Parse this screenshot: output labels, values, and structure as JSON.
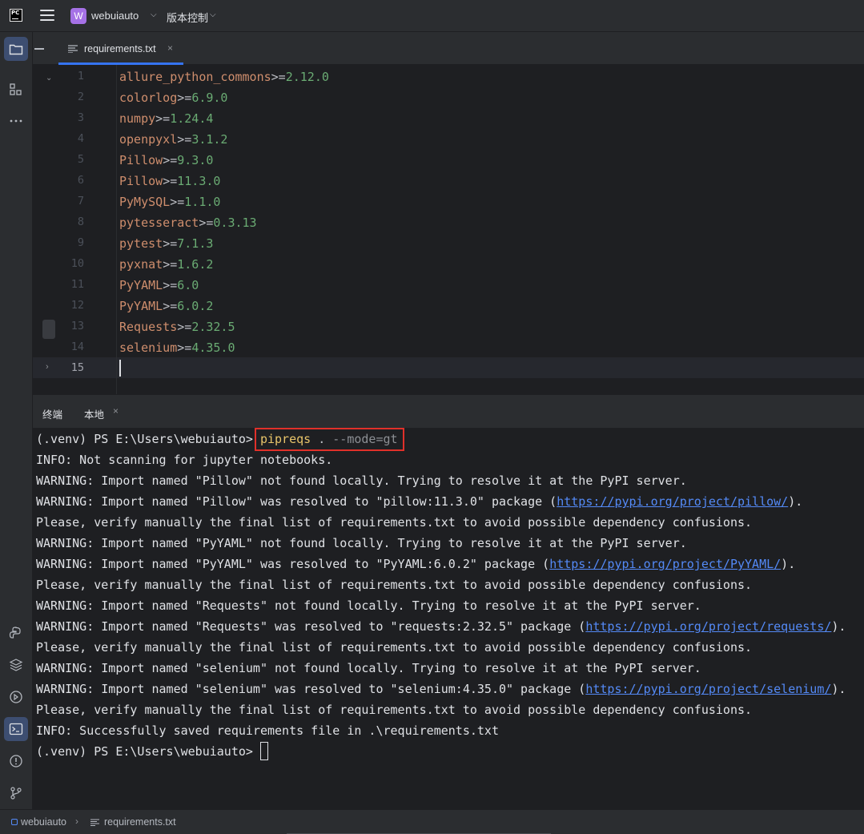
{
  "titlebar": {
    "app_logo": "PC",
    "project_badge": "W",
    "project_name": "webuiauto",
    "vcs_label": "版本控制"
  },
  "editor_tab": {
    "label": "requirements.txt",
    "close": "×"
  },
  "editor": {
    "lines": [
      {
        "no": "1",
        "pkg": "allure_python_commons",
        "op": ">=",
        "ver": "2.12.0"
      },
      {
        "no": "2",
        "pkg": "colorlog",
        "op": ">=",
        "ver": "6.9.0"
      },
      {
        "no": "3",
        "pkg": "numpy",
        "op": ">=",
        "ver": "1.24.4"
      },
      {
        "no": "4",
        "pkg": "openpyxl",
        "op": ">=",
        "ver": "3.1.2"
      },
      {
        "no": "5",
        "pkg": "Pillow",
        "op": ">=",
        "ver": "9.3.0"
      },
      {
        "no": "6",
        "pkg": "Pillow",
        "op": ">=",
        "ver": "11.3.0"
      },
      {
        "no": "7",
        "pkg": "PyMySQL",
        "op": ">=",
        "ver": "1.1.0"
      },
      {
        "no": "8",
        "pkg": "pytesseract",
        "op": ">=",
        "ver": "0.3.13"
      },
      {
        "no": "9",
        "pkg": "pytest",
        "op": ">=",
        "ver": "7.1.3"
      },
      {
        "no": "10",
        "pkg": "pyxnat",
        "op": ">=",
        "ver": "1.6.2"
      },
      {
        "no": "11",
        "pkg": "PyYAML",
        "op": ">=",
        "ver": "6.0"
      },
      {
        "no": "12",
        "pkg": "PyYAML",
        "op": ">=",
        "ver": "6.0.2"
      },
      {
        "no": "13",
        "pkg": "Requests",
        "op": ">=",
        "ver": "2.32.5"
      },
      {
        "no": "14",
        "pkg": "selenium",
        "op": ">=",
        "ver": "4.35.0"
      },
      {
        "no": "15",
        "pkg": "",
        "op": "",
        "ver": ""
      }
    ]
  },
  "terminal": {
    "title": "终端",
    "tab_label": "本地",
    "tab_close": "×",
    "prompt": "(.venv) PS E:\\Users\\webuiauto> ",
    "command": {
      "name": "pipreqs",
      "arg": " . ",
      "flag": "--mode=gt"
    },
    "output": [
      {
        "text": "INFO: Not scanning for jupyter notebooks."
      },
      {
        "text": "WARNING: Import named \"Pillow\" not found locally. Trying to resolve it at the PyPI server."
      },
      {
        "text": "WARNING: Import named \"Pillow\" was resolved to \"pillow:11.3.0\" package (",
        "link": "https://pypi.org/project/pillow/",
        "after": ")."
      },
      {
        "text": "Please, verify manually the final list of requirements.txt to avoid possible dependency confusions."
      },
      {
        "text": "WARNING: Import named \"PyYAML\" not found locally. Trying to resolve it at the PyPI server."
      },
      {
        "text": "WARNING: Import named \"PyYAML\" was resolved to \"PyYAML:6.0.2\" package (",
        "link": "https://pypi.org/project/PyYAML/",
        "after": ")."
      },
      {
        "text": "Please, verify manually the final list of requirements.txt to avoid possible dependency confusions."
      },
      {
        "text": "WARNING: Import named \"Requests\" not found locally. Trying to resolve it at the PyPI server."
      },
      {
        "text": "WARNING: Import named \"Requests\" was resolved to \"requests:2.32.5\" package (",
        "link": "https://pypi.org/project/requests/",
        "after": ")."
      },
      {
        "text": "Please, verify manually the final list of requirements.txt to avoid possible dependency confusions."
      },
      {
        "text": "WARNING: Import named \"selenium\" not found locally. Trying to resolve it at the PyPI server."
      },
      {
        "text": "WARNING: Import named \"selenium\" was resolved to \"selenium:4.35.0\" package (",
        "link": "https://pypi.org/project/selenium/",
        "after": ")."
      },
      {
        "text": "Please, verify manually the final list of requirements.txt to avoid possible dependency confusions."
      },
      {
        "text": "INFO: Successfully saved requirements file in .\\requirements.txt"
      }
    ],
    "final_prompt": "(.venv) PS E:\\Users\\webuiauto> "
  },
  "statusbar": {
    "project": "webuiauto",
    "separator": "›",
    "file": "requirements.txt"
  },
  "colors": {
    "accent": "#3574f0",
    "package": "#cf8e6d",
    "version": "#6aab73",
    "link": "#548af7",
    "highlight_box": "#e0302a",
    "command": "#e8c46a"
  }
}
